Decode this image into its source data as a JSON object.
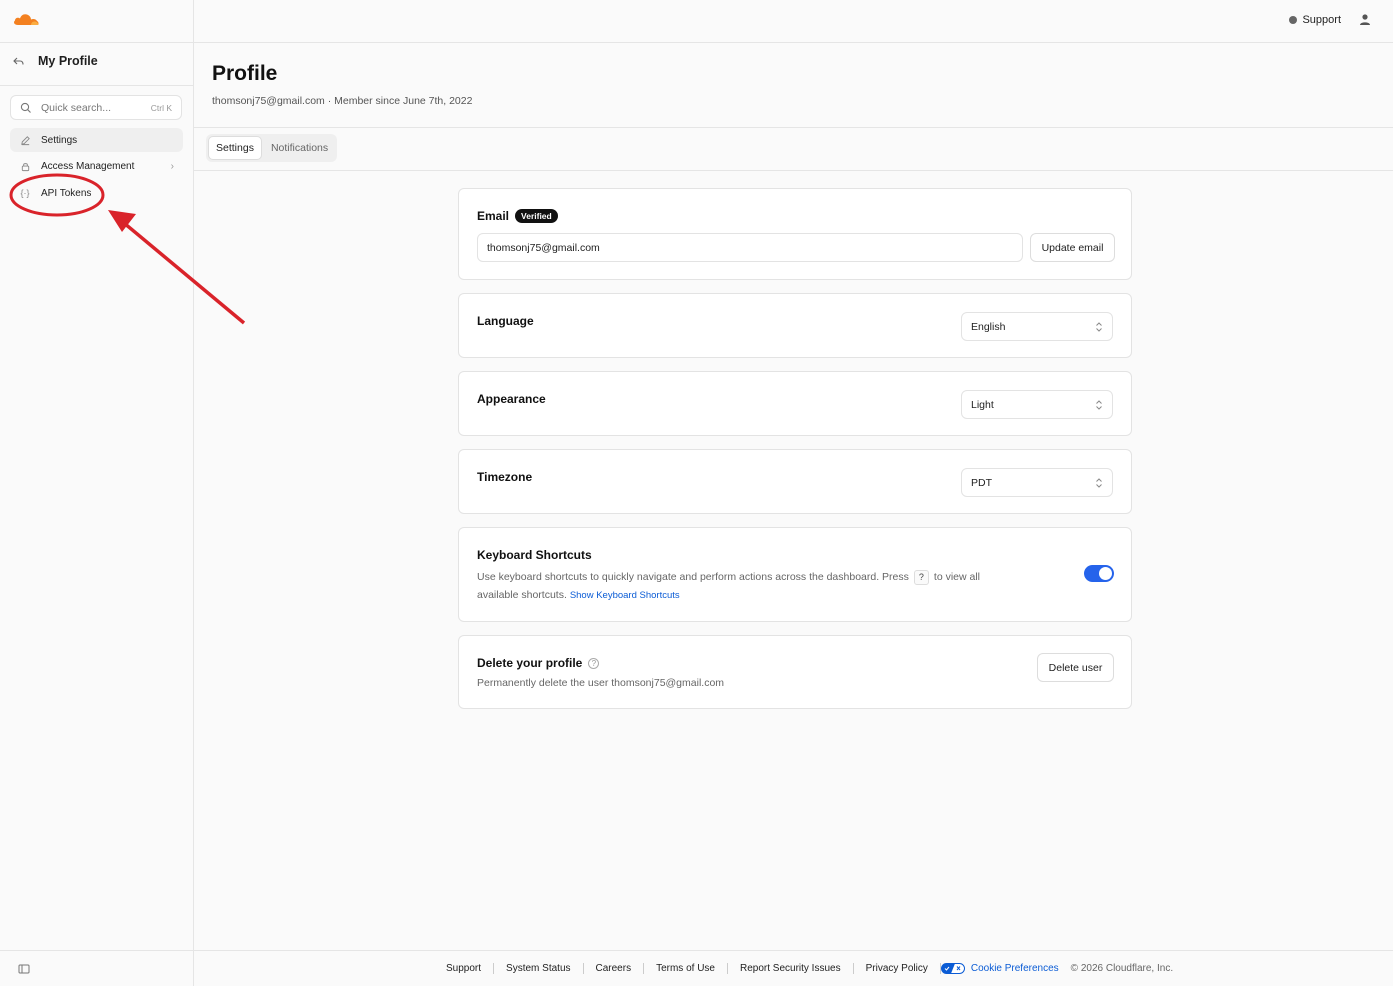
{
  "sidebar": {
    "back_title": "My Profile",
    "search": {
      "placeholder": "Quick search...",
      "shortcut": "Ctrl K"
    },
    "items": [
      {
        "label": "Settings",
        "icon": "pencil-icon",
        "active": true
      },
      {
        "label": "Access Management",
        "icon": "lock-icon",
        "has_submenu": true
      },
      {
        "label": "API Tokens",
        "icon": "braces-icon"
      }
    ]
  },
  "topbar": {
    "support_label": "Support"
  },
  "header": {
    "title": "Profile",
    "subtitle": "thomsonj75@gmail.com · Member since June 7th, 2022"
  },
  "tabs": [
    {
      "label": "Settings",
      "active": true
    },
    {
      "label": "Notifications",
      "active": false
    }
  ],
  "cards": {
    "email": {
      "title": "Email",
      "badge": "Verified",
      "value": "thomsonj75@gmail.com",
      "button": "Update email"
    },
    "language": {
      "title": "Language",
      "value": "English"
    },
    "appearance": {
      "title": "Appearance",
      "value": "Light"
    },
    "timezone": {
      "title": "Timezone",
      "value": "PDT"
    },
    "shortcuts": {
      "title": "Keyboard Shortcuts",
      "desc_before": "Use keyboard shortcuts to quickly navigate and perform actions across the dashboard. Press",
      "key": "?",
      "desc_after": "to view all",
      "desc_line2": "available shortcuts.",
      "link": "Show Keyboard Shortcuts",
      "enabled": true
    },
    "delete": {
      "title": "Delete your profile",
      "desc": "Permanently delete the user thomsonj75@gmail.com",
      "button": "Delete user"
    }
  },
  "footer": {
    "links": [
      "Support",
      "System Status",
      "Careers",
      "Terms of Use",
      "Report Security Issues",
      "Privacy Policy"
    ],
    "cookie": "Cookie Preferences",
    "copyright": "© 2026 Cloudflare, Inc."
  },
  "colors": {
    "accent": "#2563eb",
    "link": "#0b5cd5",
    "logo_orange": "#f38020",
    "annotation_red": "#d9232a"
  }
}
